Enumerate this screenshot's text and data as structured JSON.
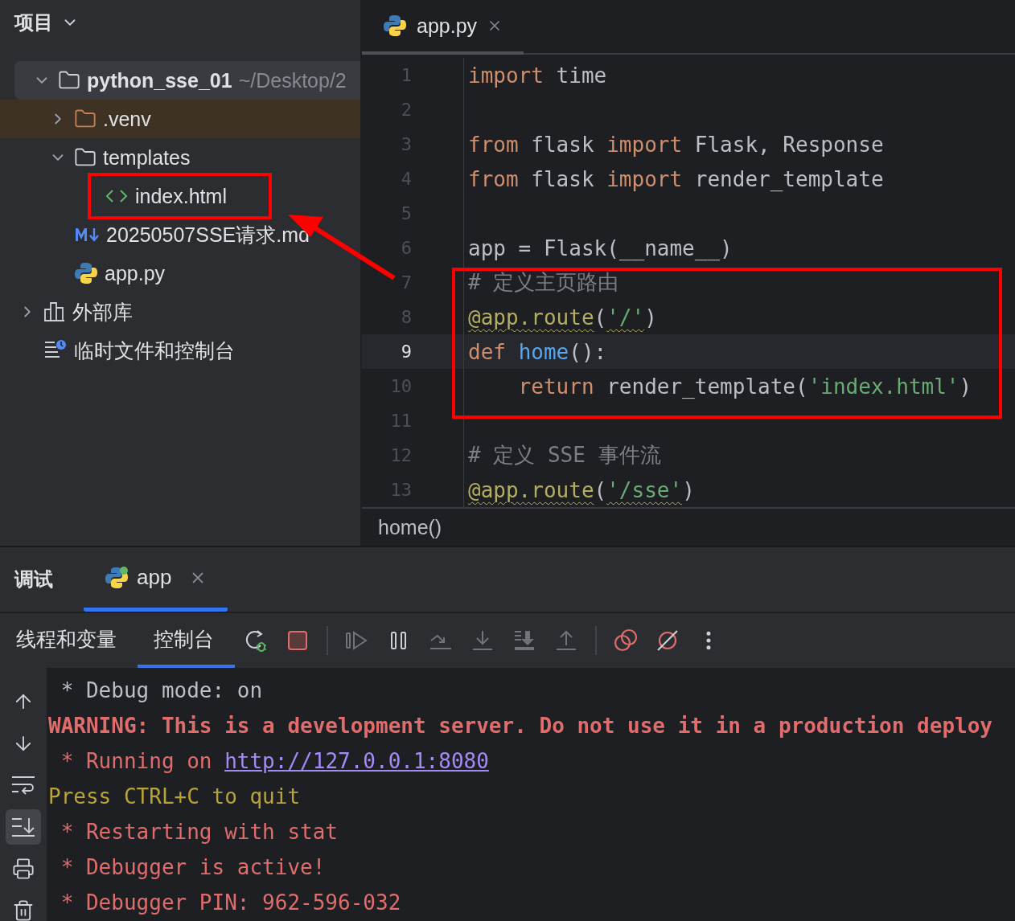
{
  "project_panel": {
    "title": "项目",
    "tree": [
      {
        "kind": "folder",
        "name": "python_sse_01",
        "hint": "~/Desktop/2",
        "expanded": true,
        "selected": true,
        "excluded": false,
        "children": [
          {
            "kind": "folder",
            "name": ".venv",
            "expanded": false,
            "selected": false,
            "excluded": true
          },
          {
            "kind": "folder",
            "name": "templates",
            "expanded": true,
            "selected": false,
            "excluded": false,
            "children": [
              {
                "kind": "html",
                "name": "index.html",
                "selected": false
              }
            ]
          },
          {
            "kind": "markdown",
            "name": "20250507SSE请求.md",
            "selected": false
          },
          {
            "kind": "python",
            "name": "app.py",
            "selected": false
          }
        ]
      },
      {
        "kind": "library",
        "name": "外部库",
        "expanded": false,
        "selected": false
      },
      {
        "kind": "scratches",
        "name": "临时文件和控制台",
        "selected": false
      }
    ]
  },
  "editor": {
    "tabs": [
      {
        "label": "app.py",
        "selected": true
      }
    ],
    "lines": [
      {
        "number": "1",
        "current": false,
        "tokens": [
          {
            "kind": "keyword",
            "text": "import"
          },
          {
            "kind": "plain",
            "text": " time"
          }
        ]
      },
      {
        "number": "2",
        "current": false
      },
      {
        "number": "3",
        "current": false,
        "tokens": [
          {
            "kind": "keyword",
            "text": "from"
          },
          {
            "kind": "plain",
            "text": " flask "
          },
          {
            "kind": "keyword",
            "text": "import"
          },
          {
            "kind": "plain",
            "text": " Flask, Response"
          }
        ]
      },
      {
        "number": "4",
        "current": false,
        "tokens": [
          {
            "kind": "keyword",
            "text": "from"
          },
          {
            "kind": "plain",
            "text": " flask "
          },
          {
            "kind": "keyword",
            "text": "import"
          },
          {
            "kind": "plain",
            "text": " render_template"
          }
        ]
      },
      {
        "number": "5",
        "current": false
      },
      {
        "number": "6",
        "current": false,
        "tokens": [
          {
            "kind": "plain",
            "text": "app = Flask(__name__)"
          }
        ]
      },
      {
        "number": "7",
        "current": false,
        "tokens": [
          {
            "kind": "comment",
            "text": "# 定义主页路由"
          }
        ]
      },
      {
        "number": "8",
        "current": false,
        "tokens": [
          {
            "kind": "decorator",
            "text": "@app.route",
            "warned": true
          },
          {
            "kind": "plain",
            "text": "("
          },
          {
            "kind": "string",
            "text": "'/'",
            "warned": true
          },
          {
            "kind": "plain",
            "text": ")"
          }
        ]
      },
      {
        "number": "9",
        "current": true,
        "tokens": [
          {
            "kind": "keyword",
            "text": "def "
          },
          {
            "kind": "function",
            "text": "home"
          },
          {
            "kind": "plain",
            "text": "():"
          }
        ]
      },
      {
        "number": "10",
        "current": false,
        "tokens": [
          {
            "kind": "keyword",
            "text": "    return"
          },
          {
            "kind": "plain",
            "text": " render_template("
          },
          {
            "kind": "string",
            "text": "'index.html'"
          },
          {
            "kind": "plain",
            "text": ")"
          }
        ]
      },
      {
        "number": "11",
        "current": false
      },
      {
        "number": "12",
        "current": false,
        "tokens": [
          {
            "kind": "comment",
            "text": "# 定义 SSE 事件流"
          }
        ]
      },
      {
        "number": "13",
        "current": false,
        "tokens": [
          {
            "kind": "decorator",
            "text": "@app.route",
            "warned": true
          },
          {
            "kind": "plain",
            "text": "("
          },
          {
            "kind": "string",
            "text": "'/sse'",
            "warned": true
          },
          {
            "kind": "plain",
            "text": ")"
          }
        ]
      }
    ],
    "breadcrumb": "home()"
  },
  "debug_panel": {
    "title": "调试",
    "sessions": [
      {
        "label": "app",
        "selected": true
      }
    ],
    "views": [
      {
        "label": "线程和变量",
        "selected": false
      },
      {
        "label": "控制台",
        "selected": true
      }
    ],
    "tools": [
      {
        "kind": "rerun",
        "disabled": false
      },
      {
        "kind": "stop",
        "disabled": false
      },
      {
        "kind": "separator"
      },
      {
        "kind": "resume",
        "disabled": true
      },
      {
        "kind": "pause",
        "disabled": false
      },
      {
        "kind": "step-over",
        "disabled": true
      },
      {
        "kind": "step-into",
        "disabled": true
      },
      {
        "kind": "force-step-into",
        "disabled": true
      },
      {
        "kind": "step-out",
        "disabled": true
      },
      {
        "kind": "separator"
      },
      {
        "kind": "breakpoints",
        "disabled": false
      },
      {
        "kind": "mute",
        "disabled": false
      },
      {
        "kind": "more",
        "disabled": false
      }
    ],
    "side_tools": [
      {
        "kind": "up",
        "selected": false
      },
      {
        "kind": "down",
        "selected": false
      },
      {
        "kind": "wrap",
        "selected": false
      },
      {
        "kind": "scroll-end",
        "selected": true
      },
      {
        "kind": "print",
        "selected": false
      },
      {
        "kind": "trash",
        "selected": false
      }
    ],
    "console": [
      {
        "kind": "info",
        "segments": [
          {
            "kind": "text",
            "text": " * Debug mode: on"
          }
        ]
      },
      {
        "kind": "warning",
        "segments": [
          {
            "kind": "text",
            "text": "WARNING: This is a development server. Do not use it in a production deploy"
          }
        ]
      },
      {
        "kind": "error",
        "segments": [
          {
            "kind": "text",
            "text": " * Running on "
          },
          {
            "kind": "link",
            "text": "http://127.0.0.1:8080"
          }
        ]
      },
      {
        "kind": "notice",
        "segments": [
          {
            "kind": "text",
            "text": "Press CTRL+C to quit"
          }
        ]
      },
      {
        "kind": "error",
        "segments": [
          {
            "kind": "text",
            "text": " * Restarting with stat"
          }
        ]
      },
      {
        "kind": "error",
        "segments": [
          {
            "kind": "text",
            "text": " * Debugger is active!"
          }
        ]
      },
      {
        "kind": "error",
        "segments": [
          {
            "kind": "text",
            "text": " * Debugger PIN: 962-596-032"
          }
        ]
      }
    ]
  }
}
